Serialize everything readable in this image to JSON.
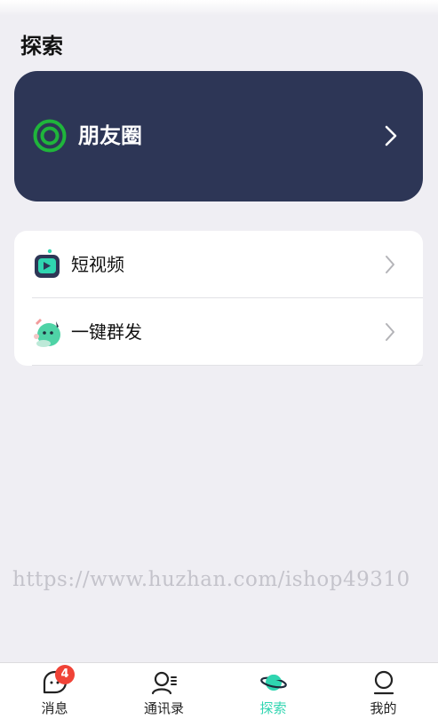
{
  "page": {
    "title": "探索"
  },
  "moments": {
    "label": "朋友圈",
    "accent": "#1fb53b",
    "card_color": "#2d3656"
  },
  "list": {
    "items": [
      {
        "label": "短视频",
        "icon": "video-tv-icon"
      },
      {
        "label": "一键群发",
        "icon": "broadcast-mascot-icon"
      }
    ]
  },
  "watermark": {
    "text": "https://www.huzhan.com/ishop49310"
  },
  "tabbar": {
    "active_color": "#2fd5b0",
    "tabs": [
      {
        "label": "消息",
        "icon": "chat-bubble-icon",
        "badge": "4"
      },
      {
        "label": "通讯录",
        "icon": "contacts-icon"
      },
      {
        "label": "探索",
        "icon": "planet-icon",
        "active": true
      },
      {
        "label": "我的",
        "icon": "profile-icon"
      }
    ]
  }
}
